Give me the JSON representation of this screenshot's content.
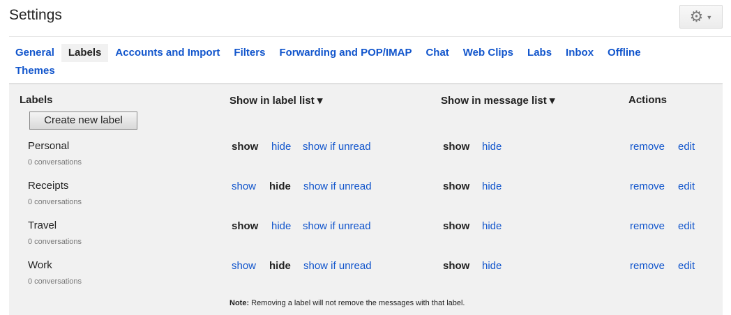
{
  "page": {
    "title": "Settings"
  },
  "tabs": [
    {
      "label": "General",
      "active": false
    },
    {
      "label": "Labels",
      "active": true
    },
    {
      "label": "Accounts and Import",
      "active": false
    },
    {
      "label": "Filters",
      "active": false
    },
    {
      "label": "Forwarding and POP/IMAP",
      "active": false
    },
    {
      "label": "Chat",
      "active": false
    },
    {
      "label": "Web Clips",
      "active": false
    },
    {
      "label": "Labs",
      "active": false
    },
    {
      "label": "Inbox",
      "active": false
    },
    {
      "label": "Offline",
      "active": false
    },
    {
      "label": "Themes",
      "active": false
    }
  ],
  "table": {
    "headers": {
      "labels": "Labels",
      "label_list": "Show in label list ▾",
      "message_list": "Show in message list ▾",
      "actions": "Actions"
    },
    "create_button": "Create new label",
    "rows": [
      {
        "name": "Personal",
        "count": "0 conversations",
        "label_list": "show"
      },
      {
        "name": "Receipts",
        "count": "0 conversations",
        "label_list": "hide"
      },
      {
        "name": "Travel",
        "count": "0 conversations",
        "label_list": "show"
      },
      {
        "name": "Work",
        "count": "0 conversations",
        "label_list": "hide"
      }
    ],
    "option_labels": {
      "show": "show",
      "hide": "hide",
      "show_if_unread": "show if unread",
      "remove": "remove",
      "edit": "edit"
    }
  },
  "note": {
    "prefix": "Note:",
    "text": " Removing a label will not remove the messages with that label."
  },
  "colors": {
    "link": "#1155cc",
    "panel": "#f1f1f1"
  }
}
